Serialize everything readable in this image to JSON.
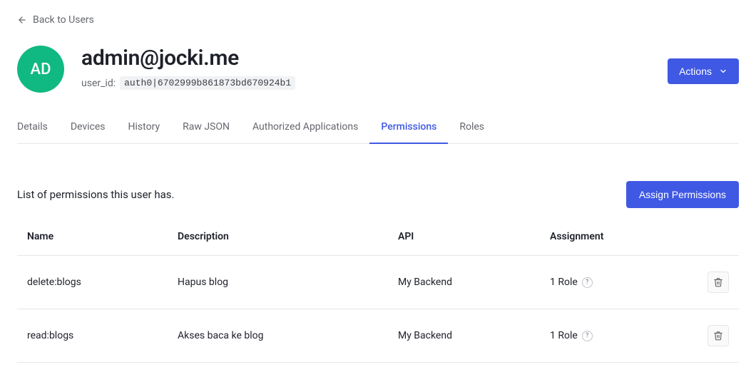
{
  "back_link": {
    "label": "Back to Users"
  },
  "user": {
    "avatar_initials": "AD",
    "email": "admin@jocki.me",
    "user_id_label": "user_id:",
    "user_id_value": "auth0|6702999b861873bd670924b1"
  },
  "actions_button": {
    "label": "Actions"
  },
  "tabs": [
    {
      "label": "Details"
    },
    {
      "label": "Devices"
    },
    {
      "label": "History"
    },
    {
      "label": "Raw JSON"
    },
    {
      "label": "Authorized Applications"
    },
    {
      "label": "Permissions"
    },
    {
      "label": "Roles"
    }
  ],
  "permissions_section": {
    "description": "List of permissions this user has.",
    "assign_button": "Assign Permissions",
    "columns": {
      "name": "Name",
      "description": "Description",
      "api": "API",
      "assignment": "Assignment"
    },
    "rows": [
      {
        "name": "delete:blogs",
        "description": "Hapus blog",
        "api": "My Backend",
        "assignment": "1 Role"
      },
      {
        "name": "read:blogs",
        "description": "Akses baca ke blog",
        "api": "My Backend",
        "assignment": "1 Role"
      }
    ]
  }
}
